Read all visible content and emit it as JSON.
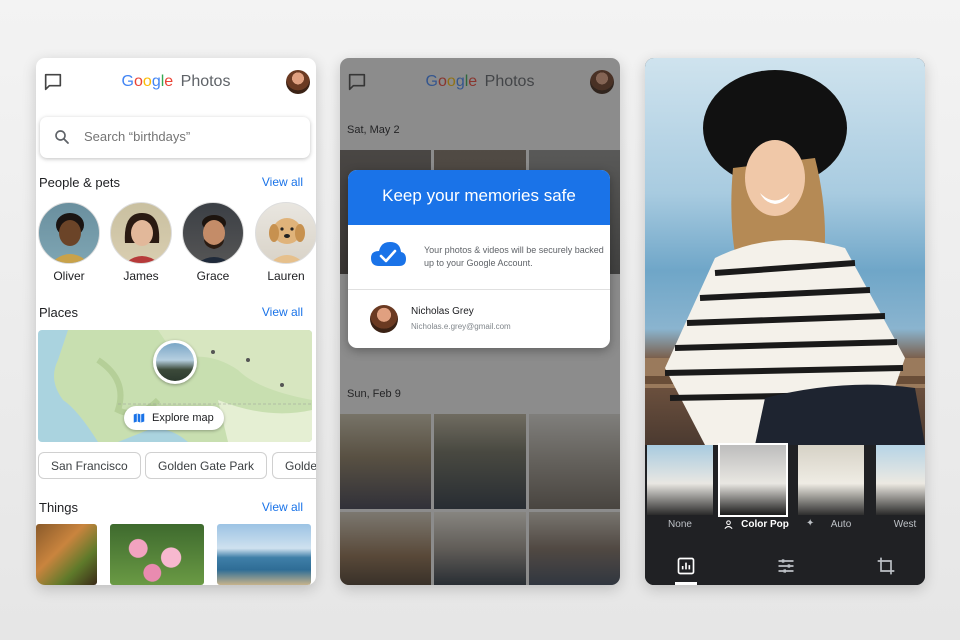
{
  "phone1": {
    "logo_google": "Google",
    "logo_photos": "Photos",
    "search_placeholder": "Search “birthdays”",
    "people_title": "People & pets",
    "people_viewall": "View all",
    "people": [
      {
        "name": "Oliver"
      },
      {
        "name": "James"
      },
      {
        "name": "Grace"
      },
      {
        "name": "Lauren"
      }
    ],
    "places_title": "Places",
    "places_viewall": "View all",
    "explore_label": "Explore map",
    "place_chips": [
      "San Francisco",
      "Golden Gate Park",
      "Golden"
    ],
    "things_title": "Things",
    "things_viewall": "View all"
  },
  "phone2": {
    "logo_google": "Google",
    "logo_photos": "Photos",
    "date1": "Sat, May 2",
    "date2": "Sun, Feb 9",
    "dialog_title": "Keep your memories safe",
    "dialog_message": "Your photos & videos will be securely backed up to your Google Account.",
    "user_name": "Nicholas Grey",
    "user_email": "Nicholas.e.grey@gmail.com"
  },
  "phone3": {
    "filters": [
      {
        "label": "None",
        "icon": ""
      },
      {
        "label": "Color Pop",
        "icon": "person-icon"
      },
      {
        "label": "Auto",
        "icon": "sparkle-icon"
      },
      {
        "label": "West",
        "icon": ""
      }
    ],
    "active_filter": "Color Pop",
    "bottom_icons": [
      "filters-icon",
      "adjust-icon",
      "crop-rotate-icon"
    ]
  },
  "colors": {
    "accent_blue": "#1a73e8",
    "editor_dark": "#202124"
  }
}
